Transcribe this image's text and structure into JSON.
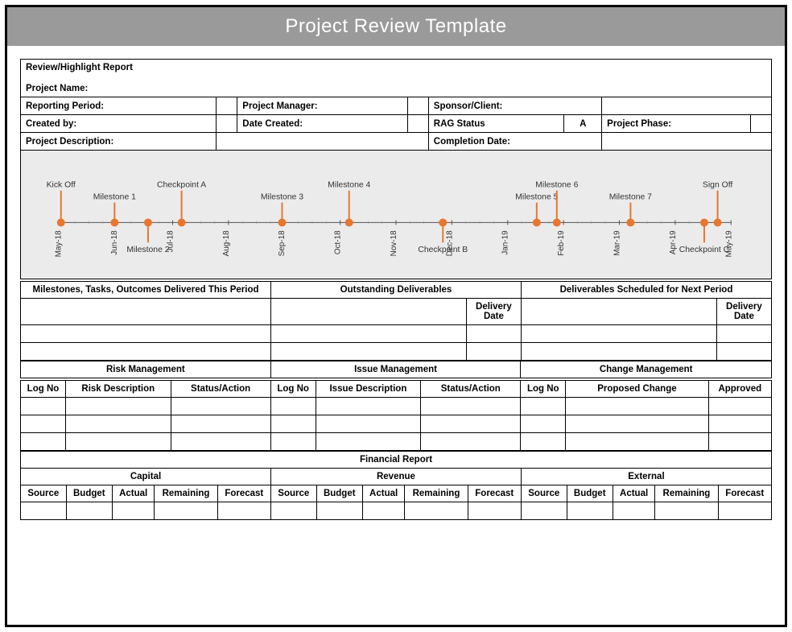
{
  "title": "Project Review Template",
  "header": {
    "report_title": "Review/Highlight Report",
    "project_name_label": "Project Name:",
    "reporting_period_label": "Reporting Period:",
    "project_manager_label": "Project Manager:",
    "sponsor_client_label": "Sponsor/Client:",
    "created_by_label": "Created by:",
    "date_created_label": "Date Created:",
    "rag_status_label": "RAG Status",
    "rag_status_value": "A",
    "project_phase_label": "Project Phase:",
    "project_description_label": "Project Description:",
    "completion_date_label": "Completion Date:"
  },
  "timeline": {
    "axis_labels": [
      "May-18",
      "Jun-18",
      "Jul-18",
      "Aug-18",
      "Sep-18",
      "Oct-18",
      "Nov-18",
      "Dec-18",
      "Jan-19",
      "Feb-19",
      "Mar-19",
      "Apr-19",
      "May-19"
    ],
    "events": [
      {
        "label": "Kick Off",
        "pos": 0,
        "stem": 40,
        "y": "top"
      },
      {
        "label": "Milestone 1",
        "pos": 8,
        "stem": 25,
        "y": "top"
      },
      {
        "label": "Milestone 2",
        "pos": 13,
        "stem": 25,
        "y": "bottom"
      },
      {
        "label": "Checkpoint A",
        "pos": 18,
        "stem": 40,
        "y": "top"
      },
      {
        "label": "Milestone 3",
        "pos": 33,
        "stem": 25,
        "y": "top"
      },
      {
        "label": "Milestone 4",
        "pos": 43,
        "stem": 40,
        "y": "top"
      },
      {
        "label": "Checkpoint B",
        "pos": 57,
        "stem": 25,
        "y": "bottom"
      },
      {
        "label": "Milestone 5",
        "pos": 71,
        "stem": 25,
        "y": "top"
      },
      {
        "label": "Milestone 6",
        "pos": 74,
        "stem": 40,
        "y": "top"
      },
      {
        "label": "Milestone 7",
        "pos": 85,
        "stem": 25,
        "y": "top"
      },
      {
        "label": "Checkpoint C",
        "pos": 96,
        "stem": 25,
        "y": "bottom"
      },
      {
        "label": "Sign Off",
        "pos": 98,
        "stem": 40,
        "y": "top"
      }
    ]
  },
  "deliverables": {
    "col1": "Milestones, Tasks, Outcomes Delivered This Period",
    "col2": "Outstanding Deliverables",
    "col3": "Deliverables Scheduled for Next Period",
    "delivery_date": "Delivery Date"
  },
  "mgmt": {
    "risk": "Risk Management",
    "issue": "Issue Management",
    "change": "Change Management",
    "log_no": "Log No",
    "risk_desc": "Risk Description",
    "status_action": "Status/Action",
    "issue_desc": "Issue Description",
    "proposed_change": "Proposed Change",
    "approved": "Approved"
  },
  "fin": {
    "title": "Financial Report",
    "capital": "Capital",
    "revenue": "Revenue",
    "external": "External",
    "source": "Source",
    "budget": "Budget",
    "actual": "Actual",
    "remaining": "Remaining",
    "forecast": "Forecast"
  }
}
